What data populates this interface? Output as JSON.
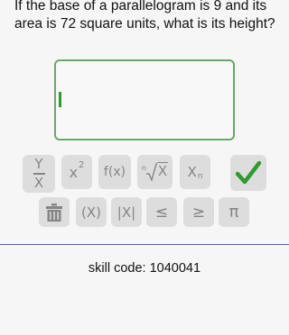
{
  "question": {
    "text": "If the base of a parallelogram is 9 and its area is 72 square units, what is its height?"
  },
  "answer": {
    "value": ""
  },
  "keypad": {
    "fraction": {
      "top": "Y",
      "bottom": "X"
    },
    "power": {
      "base": "x",
      "exp": "2"
    },
    "function": "f(x)",
    "nth_root": {
      "index": "n",
      "radicand": "X"
    },
    "subscript": {
      "base": "X",
      "sub": "n"
    },
    "submit": "✔",
    "delete_icon": "trash-icon",
    "parentheses": "(X)",
    "absolute": "|X|",
    "less_equal": "≤",
    "greater_equal": "≥",
    "pi": "π"
  },
  "footer": {
    "skill_code": "skill code: 1040041"
  },
  "colors": {
    "accent_green": "#2f9a2f",
    "box_border": "#6aa76a",
    "divider": "#5a5ad0",
    "key_bg": "#dddddd",
    "key_fg": "#858585"
  }
}
